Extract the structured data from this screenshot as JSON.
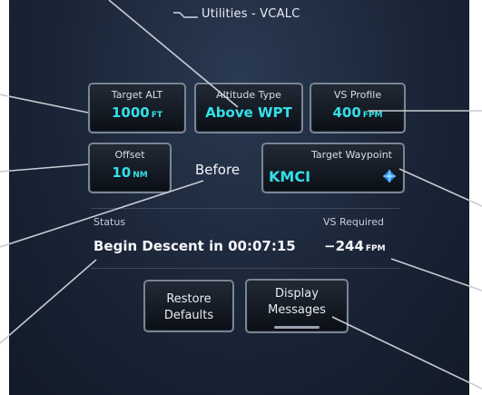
{
  "header": {
    "title": "Utilities - VCALC",
    "icon": "vcalc-icon"
  },
  "buttons": {
    "target_alt": {
      "label": "Target ALT",
      "value": "1000",
      "unit": "FT"
    },
    "altitude_type": {
      "label": "Altitude Type",
      "value": "Above WPT"
    },
    "vs_profile": {
      "label": "VS Profile",
      "value": "400",
      "unit": "FPM"
    },
    "offset": {
      "label": "Offset",
      "value": "10",
      "unit": "NM"
    },
    "target_waypoint": {
      "label": "Target Waypoint",
      "value": "KMCI",
      "icon": "waypoint-diamond-icon"
    },
    "restore_defaults": {
      "line1": "Restore",
      "line2": "Defaults"
    },
    "display_messages": {
      "line1": "Display",
      "line2": "Messages"
    }
  },
  "offset_mode": "Before",
  "status": {
    "label": "Status",
    "value": "Begin Descent in 00:07:15"
  },
  "vs_required": {
    "label": "VS Required",
    "value": "−244",
    "unit": "FPM"
  },
  "colors": {
    "accent": "#34e0e8",
    "background": "#1a2436",
    "border": "#7a8596",
    "callout": "#c8ccd2"
  }
}
